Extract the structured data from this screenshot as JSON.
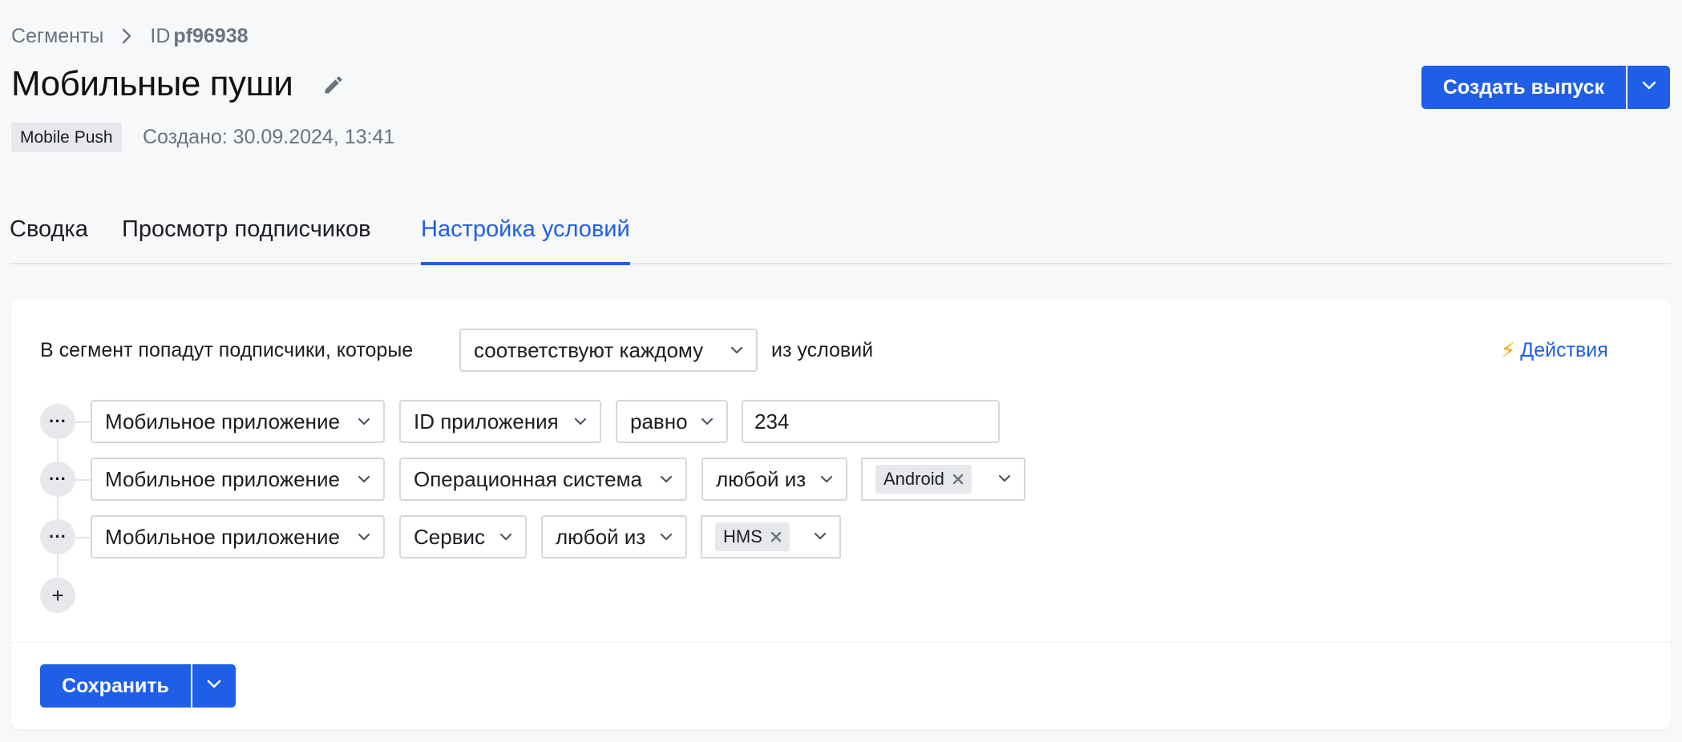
{
  "breadcrumb": {
    "parent": "Сегменты",
    "id_prefix": "ID",
    "id_value": "pf96938"
  },
  "header": {
    "title": "Мобильные пуши",
    "badge": "Mobile Push",
    "created": "Создано: 30.09.2024, 13:41",
    "create_release_label": "Создать выпуск"
  },
  "tabs": [
    {
      "label": "Сводка",
      "active": false
    },
    {
      "label": "Просмотр подписчиков",
      "active": false
    },
    {
      "label": "Настройка условий",
      "active": true
    }
  ],
  "conditions": {
    "intro_text": "В сегмент попадут подписчики, которые",
    "match_mode": "соответствуют каждому",
    "after_text": "из условий",
    "actions_label": "Действия",
    "rows": [
      {
        "source": "Мобильное приложение",
        "field": "ID приложения",
        "operator": "равно",
        "value": "234"
      },
      {
        "source": "Мобильное приложение",
        "field": "Операционная система",
        "operator": "любой из",
        "chips": [
          "Android"
        ]
      },
      {
        "source": "Мобильное приложение",
        "field": "Сервис",
        "operator": "любой из",
        "chips": [
          "HMS"
        ]
      }
    ],
    "more_label": "···",
    "add_label": "+"
  },
  "footer": {
    "save_label": "Сохранить"
  },
  "colors": {
    "accent": "#1f5fe8",
    "bolt": "#f5a400"
  },
  "icons": [
    "chevron-right-icon",
    "pencil-icon",
    "chevron-down-icon",
    "lightning-icon",
    "close-icon",
    "more-icon",
    "plus-icon"
  ]
}
